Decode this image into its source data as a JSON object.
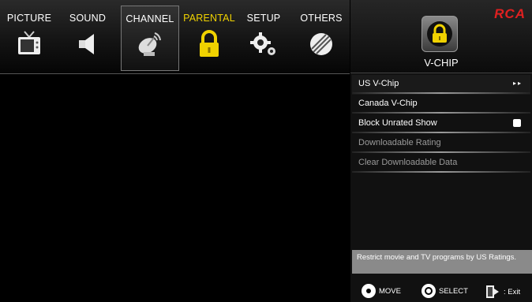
{
  "tabs": [
    {
      "label": "PICTURE",
      "icon": "tv-icon"
    },
    {
      "label": "SOUND",
      "icon": "speaker-icon"
    },
    {
      "label": "CHANNEL",
      "icon": "satellite-dish-icon"
    },
    {
      "label": "PARENTAL",
      "icon": "lock-icon"
    },
    {
      "label": "SETUP",
      "icon": "gears-icon"
    },
    {
      "label": "OTHERS",
      "icon": "others-icon"
    }
  ],
  "active_tab": "PARENTAL",
  "brand": "RCA",
  "panel": {
    "title": "V-CHIP",
    "icon": "lock-icon",
    "items": [
      {
        "label": "US V-Chip",
        "suffix": "▸▸"
      },
      {
        "label": "Canada V-Chip"
      },
      {
        "label": "Block Unrated Show"
      },
      {
        "label": "Downloadable Rating"
      },
      {
        "label": "Clear Downloadable Data"
      }
    ],
    "help_text": "Restrict movie and TV programs by US Ratings."
  },
  "footer": {
    "move": "MOVE",
    "select": "SELECT",
    "exit": ": Exit"
  },
  "colors": {
    "active": "#f0d200",
    "brand": "#e02020",
    "help_bg": "#8a8a8a"
  }
}
